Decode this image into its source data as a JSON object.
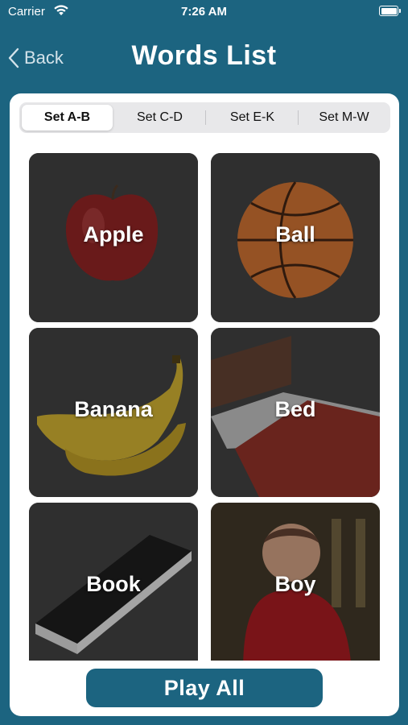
{
  "status_bar": {
    "carrier": "Carrier",
    "time": "7:26 AM"
  },
  "nav": {
    "back_label": "Back",
    "title": "Words List"
  },
  "segments": [
    {
      "label": "Set A-B",
      "selected": true
    },
    {
      "label": "Set C-D",
      "selected": false
    },
    {
      "label": "Set E-K",
      "selected": false
    },
    {
      "label": "Set M-W",
      "selected": false
    }
  ],
  "words": [
    {
      "label": "Apple",
      "image": "red-apple"
    },
    {
      "label": "Ball",
      "image": "basketball"
    },
    {
      "label": "Banana",
      "image": "banana-bunch"
    },
    {
      "label": "Bed",
      "image": "bed-with-red-blanket"
    },
    {
      "label": "Book",
      "image": "black-book"
    },
    {
      "label": "Boy",
      "image": "smiling-toddler-boy"
    }
  ],
  "play_all_label": "Play All",
  "colors": {
    "background": "#1c6480",
    "card": "#ffffff",
    "tile_overlay": "#2a2a2a",
    "button": "#1c6480"
  }
}
